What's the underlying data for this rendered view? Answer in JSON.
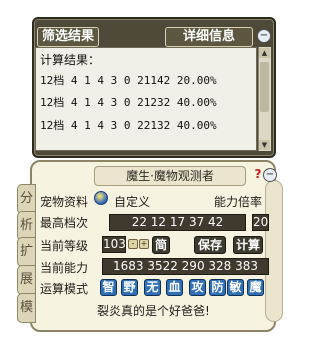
{
  "upper": {
    "filter_label": "筛选结果",
    "detail_label": "详细信息",
    "close_glyph": "−",
    "result_title": "计算结果：",
    "results": [
      "12档 4 1 4 3 0 21142 20.00%",
      "12档 4 1 4 3 0 21232 40.00%",
      "12档 4 1 4 3 0 22132 40.00%"
    ]
  },
  "lower": {
    "title": "魔生·魔物观测者",
    "help_glyph": "?",
    "close_glyph": "−",
    "side_tabs": [
      "分",
      "析",
      "扩",
      "展",
      "模"
    ],
    "pet_label": "宠物资料",
    "custom_label": "自定义",
    "multiplier_label": "能力倍率",
    "max_label": "最高档次",
    "max_value": "22 12 17 37 42",
    "multiplier_value": "20",
    "level_label": "当前等级",
    "level_value": "103",
    "minus": "-",
    "plus": "+",
    "simple_btn": "简",
    "save_btn": "保存",
    "calc_btn": "计算",
    "ability_label": "当前能力",
    "ability_value": "1683 3522 290 328 383",
    "mode_label": "运算模式",
    "modes": [
      "智",
      "野",
      "无",
      "血",
      "攻",
      "防",
      "敏",
      "魔"
    ],
    "footer": "裂炎真的是个好爸爸!"
  }
}
